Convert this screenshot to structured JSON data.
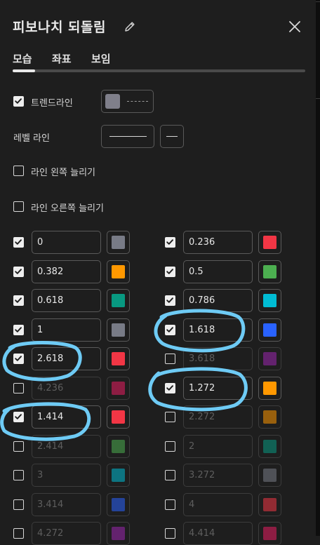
{
  "dialog": {
    "title": "피보나치 되돌림"
  },
  "tabs": [
    {
      "label": "모습",
      "active": true
    },
    {
      "label": "좌표",
      "active": false
    },
    {
      "label": "보임",
      "active": false
    }
  ],
  "trendline": {
    "label": "트렌드라인",
    "checked": true,
    "color": "#7f7f8a",
    "style": "dashed"
  },
  "level_line": {
    "label": "레벨 라인",
    "style": "solid"
  },
  "extend_left": {
    "label": "라인 왼쪽 늘리기",
    "checked": false
  },
  "extend_right": {
    "label": "라인 오른쪽 늘리기",
    "checked": false
  },
  "levels": [
    {
      "value": "0",
      "enabled": true,
      "color": "#787b86"
    },
    {
      "value": "0.236",
      "enabled": true,
      "color": "#f23645"
    },
    {
      "value": "0.382",
      "enabled": true,
      "color": "#ff9800"
    },
    {
      "value": "0.5",
      "enabled": true,
      "color": "#4caf50"
    },
    {
      "value": "0.618",
      "enabled": true,
      "color": "#089981"
    },
    {
      "value": "0.786",
      "enabled": true,
      "color": "#00bcd4"
    },
    {
      "value": "1",
      "enabled": true,
      "color": "#787b86"
    },
    {
      "value": "1.618",
      "enabled": true,
      "color": "#2962ff"
    },
    {
      "value": "2.618",
      "enabled": true,
      "color": "#f23645"
    },
    {
      "value": "3.618",
      "enabled": false,
      "color": "#9c27b0"
    },
    {
      "value": "4.236",
      "enabled": false,
      "color": "#e91e63"
    },
    {
      "value": "1.272",
      "enabled": true,
      "color": "#ff9800"
    },
    {
      "value": "1.414",
      "enabled": true,
      "color": "#f23645"
    },
    {
      "value": "2.272",
      "enabled": false,
      "color": "#ff9800"
    },
    {
      "value": "2.414",
      "enabled": false,
      "color": "#4caf50"
    },
    {
      "value": "2",
      "enabled": false,
      "color": "#089981"
    },
    {
      "value": "3",
      "enabled": false,
      "color": "#00bcd4"
    },
    {
      "value": "3.272",
      "enabled": false,
      "color": "#787b86"
    },
    {
      "value": "3.414",
      "enabled": false,
      "color": "#2962ff"
    },
    {
      "value": "4",
      "enabled": false,
      "color": "#f23645"
    },
    {
      "value": "4.272",
      "enabled": false,
      "color": "#9c27b0"
    },
    {
      "value": "4.414",
      "enabled": false,
      "color": "#e91e63"
    }
  ],
  "annotation_color": "#6ecbf5"
}
